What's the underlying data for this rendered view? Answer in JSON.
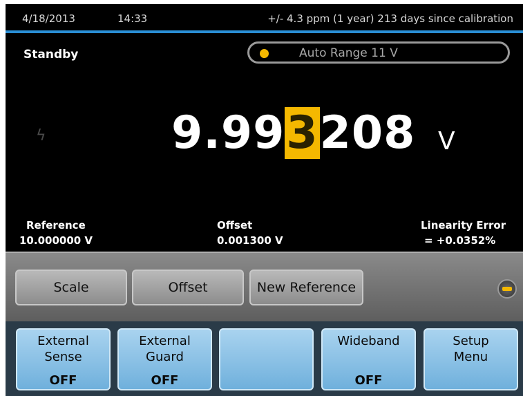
{
  "status_bar": {
    "date": "4/18/2013",
    "time": "14:33",
    "calibration": "+/- 4.3 ppm (1 year)  213 days since calibration"
  },
  "mode": {
    "status": "Standby",
    "range_label": "Auto Range 11 V",
    "range_indicator_color": "#f4b800"
  },
  "reading": {
    "digits_before": "9.99",
    "digit_selected": "3",
    "digits_after": "208",
    "unit": "V",
    "side_icon": "lightning-bolt-icon"
  },
  "stats": {
    "reference_label": "Reference",
    "reference_value": "10.000000 V",
    "offset_label": "Offset",
    "offset_value": "0.001300 V",
    "linearity_label": "Linearity Error",
    "linearity_value": "=  +0.0352%"
  },
  "softkeys": {
    "scale": "Scale",
    "offset": "Offset",
    "new_reference": "New Reference",
    "minus_icon": "minus-icon"
  },
  "function_keys": [
    {
      "line1": "External",
      "line2": "Sense",
      "state": "OFF"
    },
    {
      "line1": "External",
      "line2": "Guard",
      "state": "OFF"
    },
    {
      "line1": "",
      "line2": "",
      "state": ""
    },
    {
      "line1": "Wideband",
      "line2": "",
      "state": "OFF"
    },
    {
      "line1": "Setup",
      "line2": "Menu",
      "state": ""
    }
  ],
  "colors": {
    "accent_blue": "#2a8fd6",
    "highlight_yellow": "#f4b800",
    "key_blue": "#8ec4e8"
  }
}
